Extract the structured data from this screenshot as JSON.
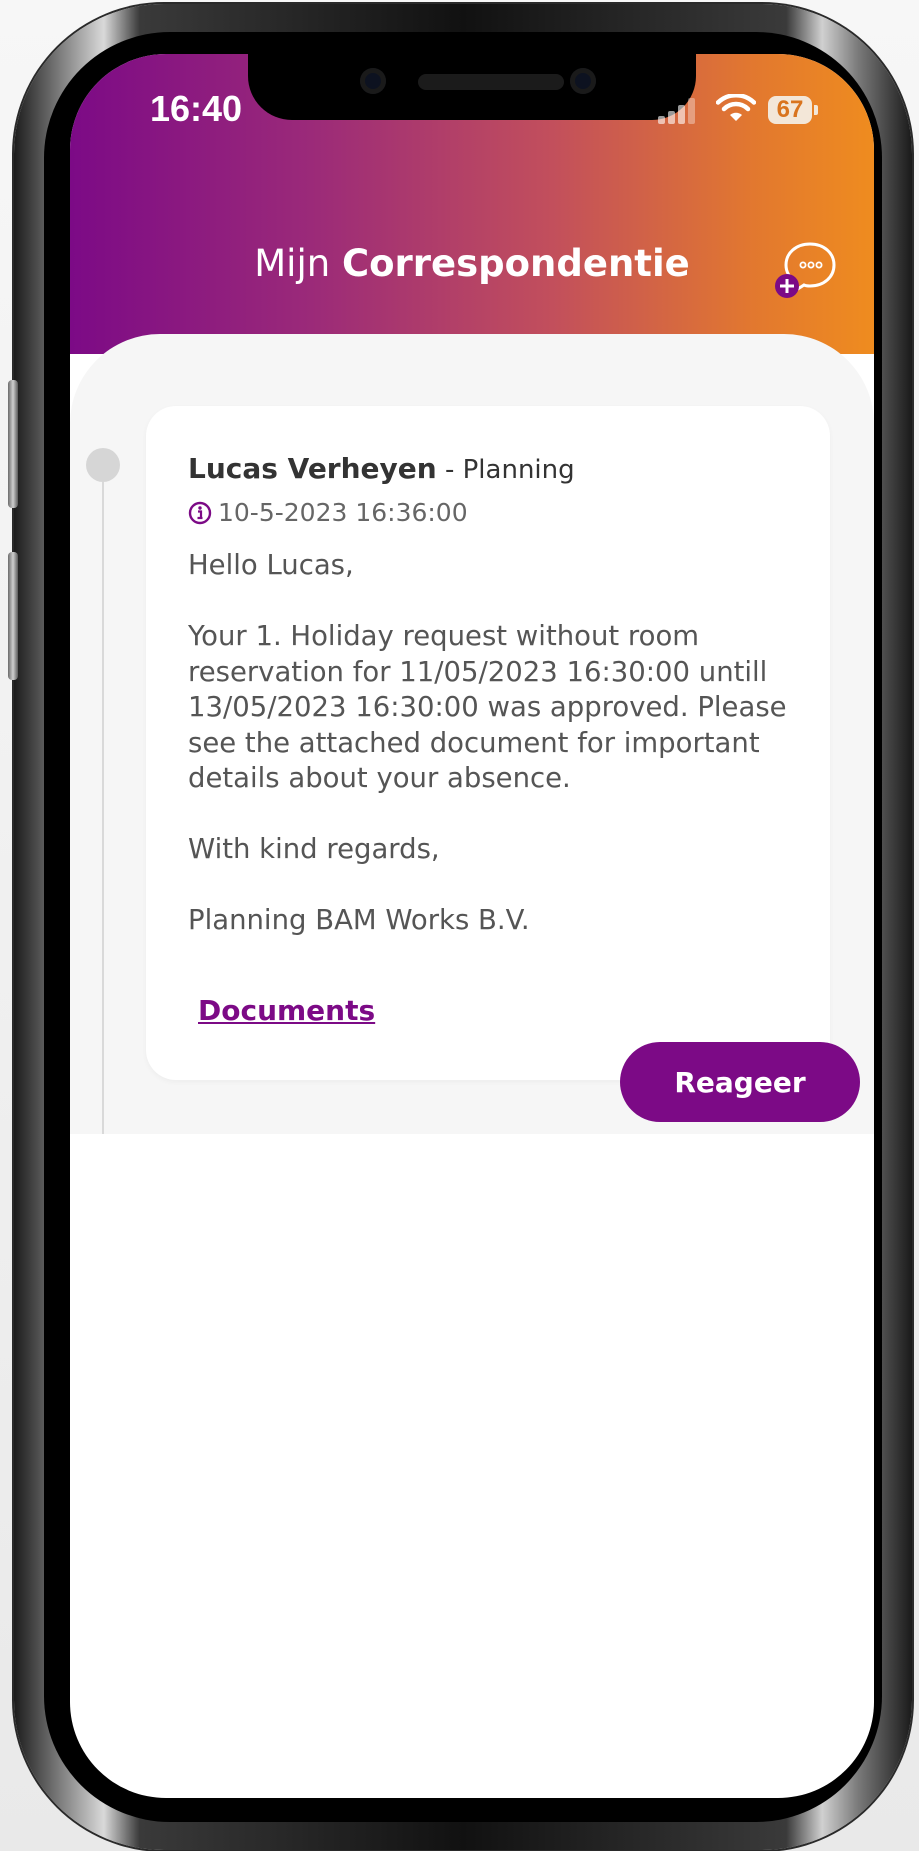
{
  "status_bar": {
    "time": "16:40",
    "battery": "67"
  },
  "header": {
    "title_light": "Mijn",
    "title_bold": "Correspondentie",
    "new_message_icon": "chat-plus-icon"
  },
  "message": {
    "sender_name": "Lucas Verheyen",
    "sender_department": " - Planning",
    "timestamp": "10-5-2023 16:36:00",
    "body": [
      "Hello Lucas,",
      "Your 1. Holiday request without room reservation for 11/05/2023 16:30:00 untill 13/05/2023 16:30:00 was approved. Please see the attached document for important details about your absence.",
      "With kind regards,",
      "Planning BAM Works B.V."
    ],
    "documents_link": "Documents",
    "reply_label": "Reageer"
  },
  "colors": {
    "brand_purple": "#7c0a86",
    "brand_orange": "#ef8c1f"
  }
}
